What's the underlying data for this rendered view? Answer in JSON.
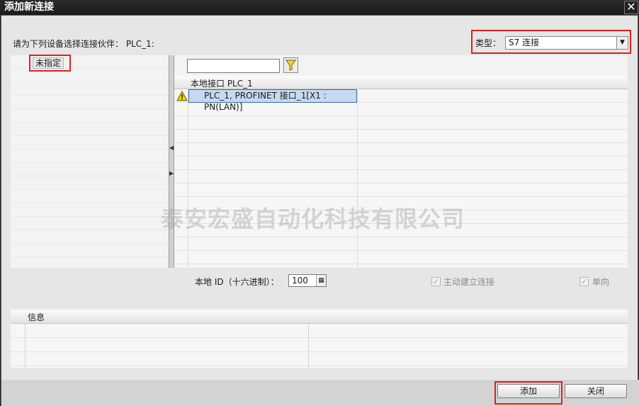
{
  "window": {
    "title": "添加新连接",
    "close_glyph": "✕"
  },
  "prompt": "请为下列设备选择连接伙伴： PLC_1:",
  "type_field": {
    "label": "类型：",
    "value": "S7 连接"
  },
  "left_tree": {
    "item": "未指定"
  },
  "table": {
    "header": "本地接口 PLC_1",
    "row": "PLC_1, PROFINET 接口_1[X1 : PN(LAN)]"
  },
  "watermark": "泰安宏盛自动化科技有限公司",
  "local_id": {
    "label": "本地 ID（十六进制）：",
    "value": "100"
  },
  "options": {
    "active_connect": "主动建立连接",
    "one_way": "单向"
  },
  "info_panel": {
    "header": "信息"
  },
  "buttons": {
    "add": "添加",
    "close": "关闭"
  },
  "colors": {
    "highlight": "#e21e1e",
    "selection": "#c7d9ef"
  },
  "icons": [
    "close-icon",
    "dropdown-arrow-icon",
    "filter-icon",
    "warning-icon",
    "collapse-left-icon",
    "expand-right-icon",
    "calculator-icon",
    "checkbox-icon"
  ]
}
